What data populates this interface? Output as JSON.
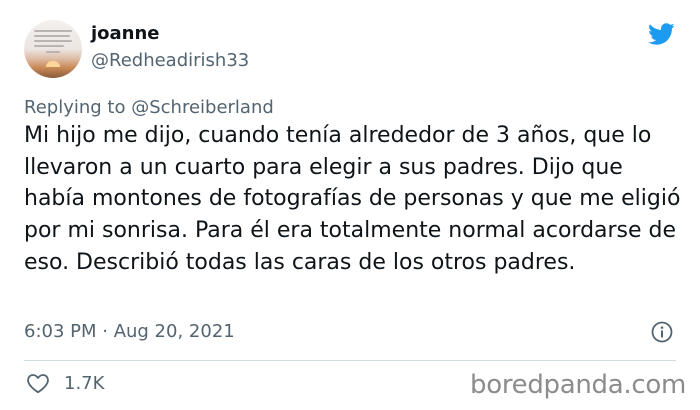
{
  "author": {
    "display_name": "joanne",
    "handle": "@Redheadirish33",
    "avatar": "avatar-sunset-quote-image"
  },
  "platform_icon": "twitter-bird-icon",
  "reply": {
    "prefix": "Replying to",
    "mention": "@Schreiberland"
  },
  "tweet": {
    "text": "Mi hijo me dijo, cuando tenía alrededor de 3 años, que lo llevaron a un cuarto para elegir a sus padres. Dijo que había montones de fotografías de personas y que me eligió por mi sonrisa. Para él era totalmente normal acordarse de eso. Describió todas las caras de los otros padres.",
    "timestamp": "6:03 PM · Aug 20, 2021"
  },
  "actions": {
    "like_icon": "heart-icon",
    "like_count": "1.7K",
    "info_icon": "info-icon"
  },
  "watermark": "boredpanda.com",
  "colors": {
    "twitter_blue": "#1d9bf0",
    "text_primary": "#0f1419",
    "text_secondary": "#536471",
    "divider": "#cfd9de"
  }
}
